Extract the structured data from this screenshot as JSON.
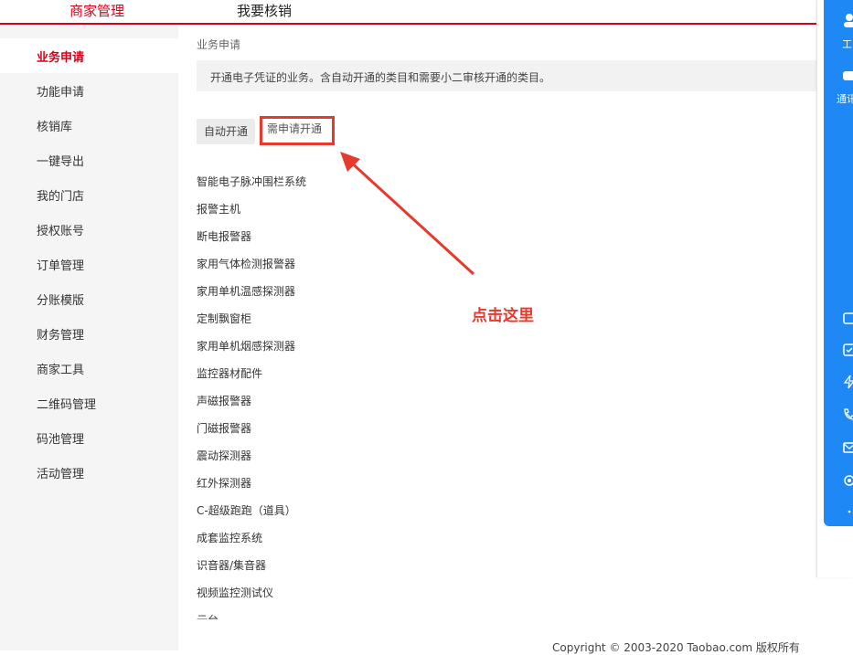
{
  "topnav": {
    "tabs": [
      {
        "label": "商家管理"
      },
      {
        "label": "我要核销"
      }
    ]
  },
  "sidebar": {
    "items": [
      {
        "label": "业务申请",
        "active": true
      },
      {
        "label": "功能申请"
      },
      {
        "label": "核销库"
      },
      {
        "label": "一键导出"
      },
      {
        "label": "我的门店"
      },
      {
        "label": "授权账号"
      },
      {
        "label": "订单管理"
      },
      {
        "label": "分账模版"
      },
      {
        "label": "财务管理"
      },
      {
        "label": "商家工具"
      },
      {
        "label": "二维码管理"
      },
      {
        "label": "码池管理"
      },
      {
        "label": "活动管理"
      }
    ]
  },
  "main": {
    "breadcrumb": "业务申请",
    "notice": "开通电子凭证的业务。含自动开通的类目和需要小二审核开通的类目。",
    "buttons": {
      "auto": "自动开通",
      "manual": "需申请开通"
    },
    "categories": [
      "智能电子脉冲围栏系统",
      "报警主机",
      "断电报警器",
      "家用气体检测报警器",
      "家用单机温感探测器",
      "定制飘窗柜",
      "家用单机烟感探测器",
      "监控器材配件",
      "声磁报警器",
      "门磁报警器",
      "震动探测器",
      "红外探测器",
      "C-超级跑跑（道具）",
      "成套监控系统",
      "识音器/集音器",
      "视频监控测试仪",
      "云台"
    ],
    "annotation": "点击这里"
  },
  "footer": {
    "copyright": "Copyright © 2003-2020 Taobao.com 版权所有"
  },
  "right_panel": {
    "labels": [
      "工",
      "通讯"
    ],
    "icons": [
      "user-icon",
      "chat-icon",
      "calendar-icon",
      "check-icon",
      "flash-icon",
      "phone-icon",
      "mail-icon",
      "settings-icon",
      "more-icon"
    ]
  },
  "colors": {
    "brand_red": "#d9001b",
    "annotation_red": "#e63a2e",
    "panel_blue": "#1e88f5"
  }
}
